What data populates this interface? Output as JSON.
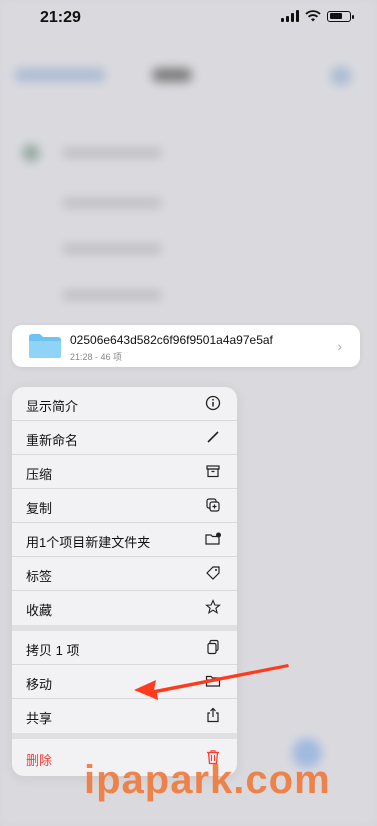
{
  "status": {
    "time": "21:29"
  },
  "preview": {
    "name": "02506e643d582c6f96f9501a4a97e5af",
    "meta": "21:28 - 46 项"
  },
  "menu": {
    "items": [
      {
        "label": "显示简介",
        "icon": "info-icon"
      },
      {
        "label": "重新命名",
        "icon": "pencil-icon"
      },
      {
        "label": "压缩",
        "icon": "archive-box-icon"
      },
      {
        "label": "复制",
        "icon": "duplicate-icon"
      },
      {
        "label": "用1个项目新建文件夹",
        "icon": "folder-badge-icon"
      },
      {
        "label": "标签",
        "icon": "tag-icon"
      },
      {
        "label": "收藏",
        "icon": "star-icon"
      },
      {
        "label": "拷贝 1 项",
        "icon": "copy-docs-icon"
      },
      {
        "label": "移动",
        "icon": "folder-icon"
      },
      {
        "label": "共享",
        "icon": "share-icon"
      },
      {
        "label": "删除",
        "icon": "trash-icon"
      }
    ]
  },
  "colors": {
    "accent_danger": "#ff3b30",
    "annotation_arrow": "#ff3b1f",
    "watermark": "#f0793a",
    "folder": "#6fc3f2"
  },
  "watermark": "ipapark.com"
}
